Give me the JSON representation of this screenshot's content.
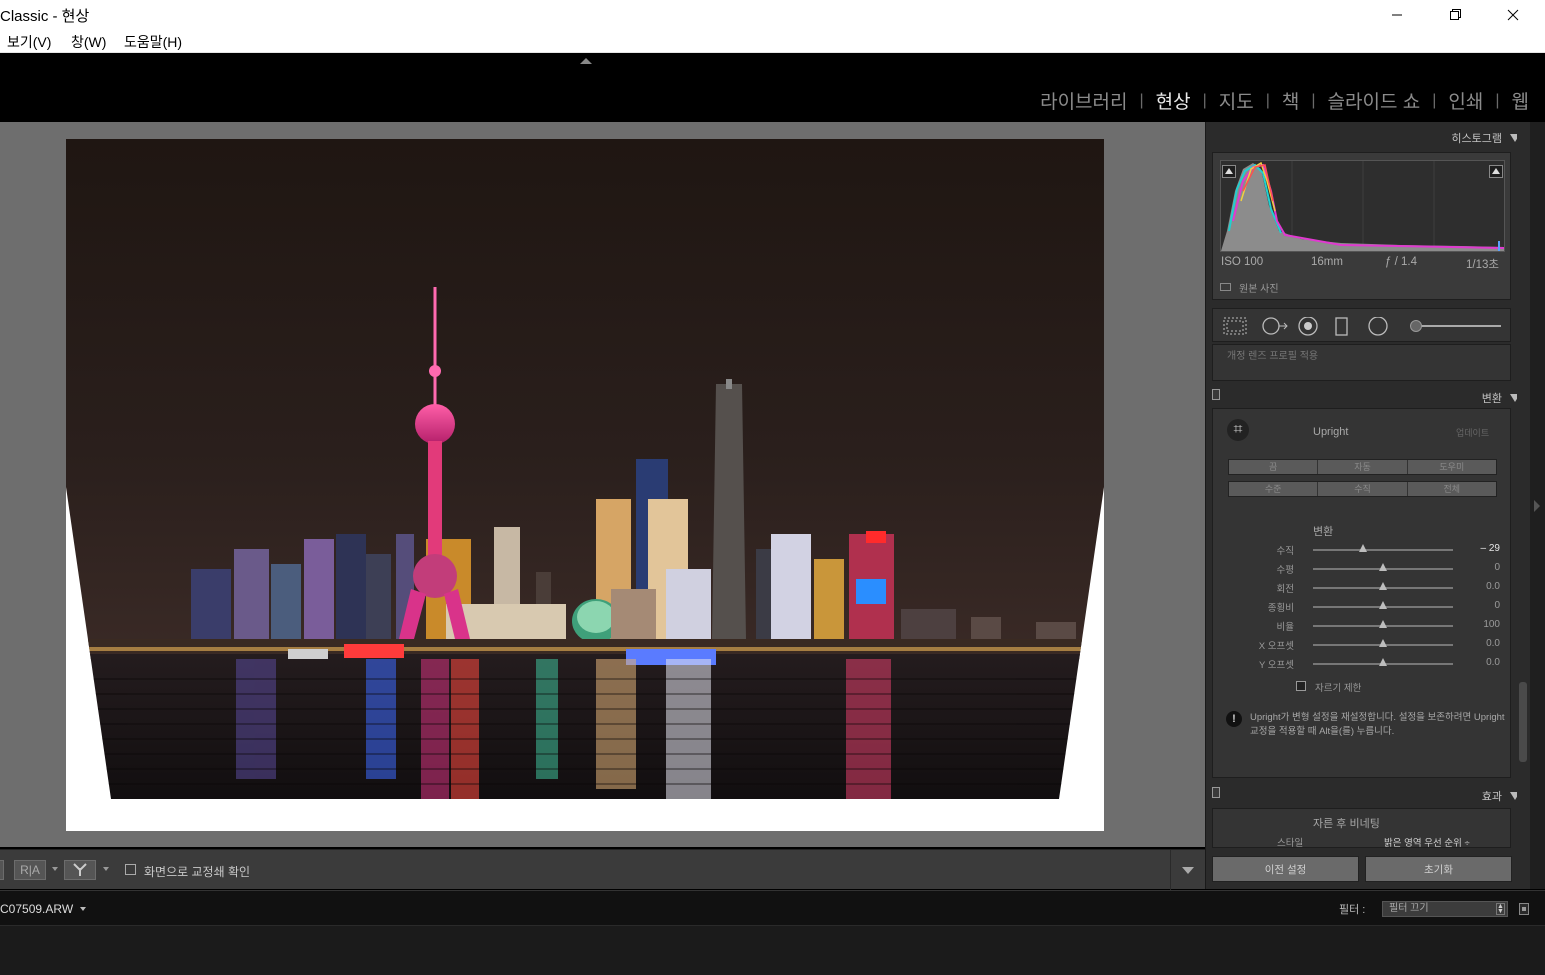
{
  "window": {
    "title": "Classic - 현상",
    "controls": {
      "minimize": "minimize-icon",
      "maximize": "maximize-icon",
      "close": "close-icon"
    }
  },
  "menu": [
    {
      "label": "보기(V)"
    },
    {
      "label": "창(W)"
    },
    {
      "label": "도움말(H)"
    }
  ],
  "modules": [
    {
      "label": "라이브러리",
      "active": false
    },
    {
      "label": "현상",
      "active": true
    },
    {
      "label": "지도",
      "active": false
    },
    {
      "label": "책",
      "active": false
    },
    {
      "label": "슬라이드 쇼",
      "active": false
    },
    {
      "label": "인쇄",
      "active": false
    },
    {
      "label": "웹",
      "active": false
    }
  ],
  "module_separator": "|",
  "histogram": {
    "title": "히스토그램",
    "iso": "ISO 100",
    "focal": "16mm",
    "aperture": "ƒ / 1.4",
    "shutter": "1/13초",
    "original_photo_label": "원본 사진"
  },
  "prev_panel_hint": "개정 렌즈 프로필 적용",
  "transform": {
    "title": "변환",
    "upright_title": "Upright",
    "update_label": "업데이트",
    "upright_buttons_row1": [
      "끔",
      "자동",
      "도우미"
    ],
    "upright_buttons_row2": [
      "수준",
      "수직",
      "전체"
    ],
    "section_title": "변환",
    "sliders": [
      {
        "label": "수직",
        "value": "– 29",
        "knob_fraction": 0.36,
        "highlight": true
      },
      {
        "label": "수평",
        "value": "0",
        "knob_fraction": 0.5,
        "highlight": false
      },
      {
        "label": "회전",
        "value": "0.0",
        "knob_fraction": 0.5,
        "highlight": false
      },
      {
        "label": "종횡비",
        "value": "0",
        "knob_fraction": 0.5,
        "highlight": false
      },
      {
        "label": "비율",
        "value": "100",
        "knob_fraction": 0.5,
        "highlight": false
      },
      {
        "label": "X 오프셋",
        "value": "0.0",
        "knob_fraction": 0.5,
        "highlight": false
      },
      {
        "label": "Y 오프셋",
        "value": "0.0",
        "knob_fraction": 0.5,
        "highlight": false
      }
    ],
    "constrain_crop_label": "자르기 제한",
    "constrain_crop_checked": false,
    "warning_text": "Upright가 변형 설정을 재설정합니다. 설정을 보존하려면 Upright 교정을 적용할 때 Alt을(를) 누릅니다."
  },
  "effects": {
    "title": "효과",
    "vignette_title": "자른 후 비네팅",
    "style_label": "스타일",
    "style_value": "밝은 영역 우선 순위 ÷"
  },
  "panel_buttons": {
    "previous": "이전 설정",
    "reset": "초기화"
  },
  "toolbar": {
    "before_after_label": "R|A",
    "proof_label": "화면으로 교정쇄 확인"
  },
  "filmstrip": {
    "filename": "C07509.ARW",
    "filter_label": "필터 :",
    "filter_value": "필터 끄기"
  }
}
